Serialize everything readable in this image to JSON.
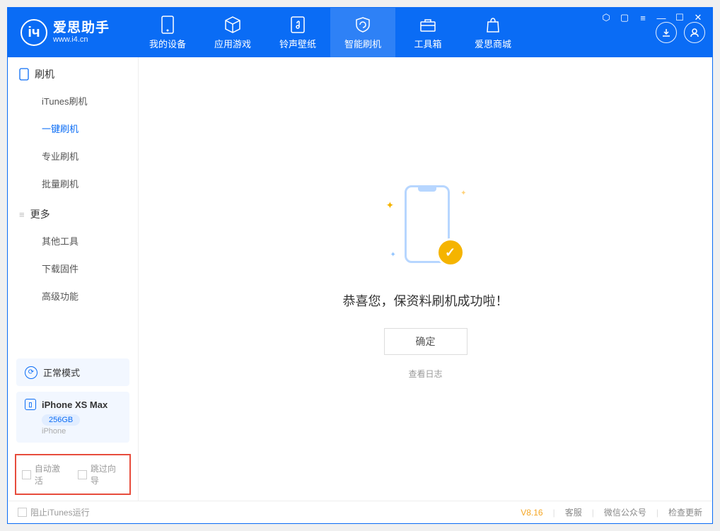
{
  "app": {
    "title": "爱思助手",
    "subtitle": "www.i4.cn"
  },
  "nav": {
    "tabs": [
      {
        "label": "我的设备"
      },
      {
        "label": "应用游戏"
      },
      {
        "label": "铃声壁纸"
      },
      {
        "label": "智能刷机"
      },
      {
        "label": "工具箱"
      },
      {
        "label": "爱思商城"
      }
    ]
  },
  "sidebar": {
    "section1": {
      "title": "刷机",
      "items": [
        "iTunes刷机",
        "一键刷机",
        "专业刷机",
        "批量刷机"
      ],
      "activeIndex": 1
    },
    "section2": {
      "title": "更多",
      "items": [
        "其他工具",
        "下载固件",
        "高级功能"
      ]
    },
    "mode": {
      "label": "正常模式"
    },
    "device": {
      "name": "iPhone XS Max",
      "storage": "256GB",
      "type": "iPhone"
    },
    "options": {
      "opt1": "自动激活",
      "opt2": "跳过向导"
    }
  },
  "main": {
    "successMessage": "恭喜您，保资料刷机成功啦！",
    "okButton": "确定",
    "logLink": "查看日志"
  },
  "statusbar": {
    "blockItunes": "阻止iTunes运行",
    "version": "V8.16",
    "links": [
      "客服",
      "微信公众号",
      "检查更新"
    ]
  }
}
